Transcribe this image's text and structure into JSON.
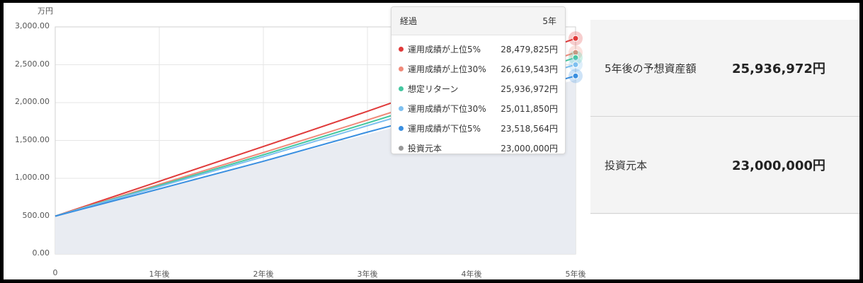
{
  "chart_data": {
    "type": "line",
    "y_unit": "万円",
    "x": [
      0,
      1,
      2,
      3,
      4,
      5
    ],
    "x_tick_labels": [
      "0",
      "1年後",
      "2年後",
      "3年後",
      "4年後",
      "5年後"
    ],
    "y_tick_labels": [
      "0.00",
      "500.00",
      "1,000.00",
      "1,500.00",
      "2,000.00",
      "2,500.00",
      "3,000.00"
    ],
    "ylim": [
      0,
      3000
    ],
    "grid": true,
    "series": [
      {
        "name": "運用成績が上位5%",
        "color": "#e03a3a",
        "values": [
          500,
          960,
          1420,
          1885,
          2365,
          2848
        ]
      },
      {
        "name": "運用成績が上位30%",
        "color": "#f08a7a",
        "values": [
          500,
          920,
          1340,
          1770,
          2210,
          2662
        ]
      },
      {
        "name": "想定リターン",
        "color": "#44c7a0",
        "values": [
          500,
          905,
          1310,
          1730,
          2155,
          2594
        ]
      },
      {
        "name": "運用成績が下位30%",
        "color": "#7ec0f0",
        "values": [
          500,
          890,
          1285,
          1695,
          2100,
          2501
        ]
      },
      {
        "name": "運用成績が下位5%",
        "color": "#3a8fe0",
        "values": [
          500,
          860,
          1225,
          1610,
          1975,
          2352
        ]
      },
      {
        "name": "投資元本",
        "color": "#9a9a9a",
        "values": [
          500,
          860,
          1220,
          1580,
          1940,
          2300
        ]
      }
    ]
  },
  "tooltip": {
    "header_label": "経過",
    "header_value": "5年",
    "rows": [
      {
        "label": "運用成績が上位5%",
        "value": "28,479,825円",
        "color": "#e03a3a"
      },
      {
        "label": "運用成績が上位30%",
        "value": "26,619,543円",
        "color": "#f08a7a"
      },
      {
        "label": "想定リターン",
        "value": "25,936,972円",
        "color": "#44c7a0"
      },
      {
        "label": "運用成績が下位30%",
        "value": "25,011,850円",
        "color": "#7ec0f0"
      },
      {
        "label": "運用成績が下位5%",
        "value": "23,518,564円",
        "color": "#3a8fe0"
      },
      {
        "label": "投資元本",
        "value": "23,000,000円",
        "color": "#9a9a9a"
      }
    ]
  },
  "summary": {
    "forecast_label": "5年後の予想資産額",
    "forecast_value": "25,936,972円",
    "principal_label": "投資元本",
    "principal_value": "23,000,000円"
  }
}
